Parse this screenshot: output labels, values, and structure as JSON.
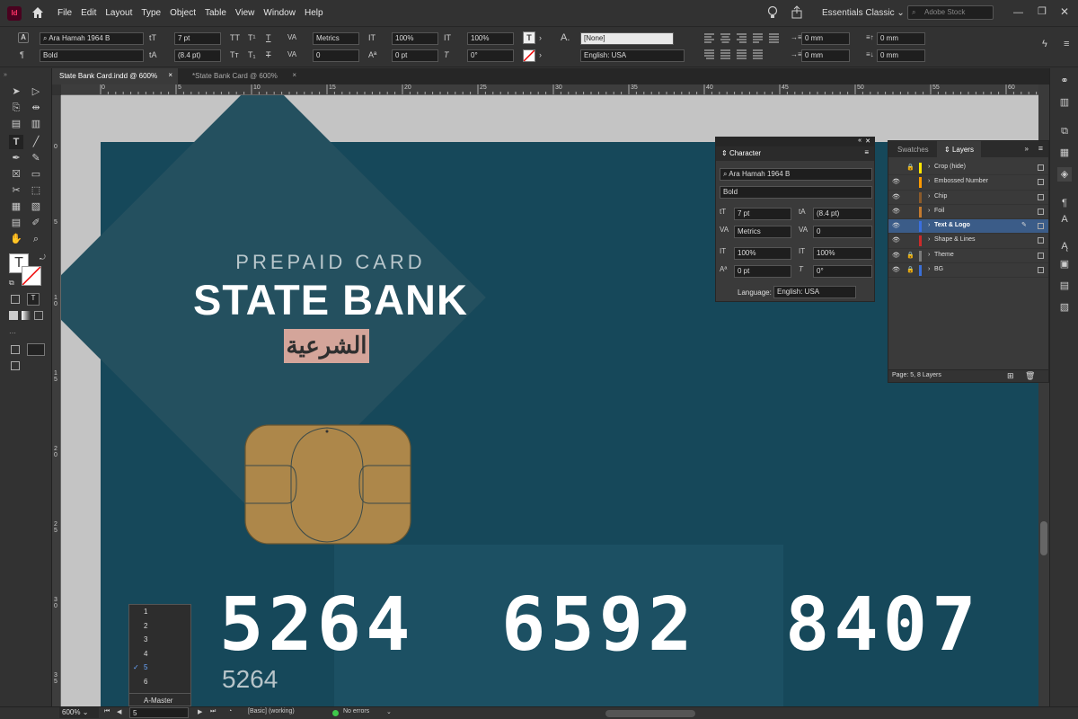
{
  "app": {
    "logo_text": "Id"
  },
  "menu": [
    "File",
    "Edit",
    "Layout",
    "Type",
    "Object",
    "Table",
    "View",
    "Window",
    "Help"
  ],
  "workspace": "Essentials Classic",
  "stock_placeholder": "Adobe Stock",
  "control": {
    "font": "Ara Hamah 1964 B",
    "style": "Bold",
    "size": "7 pt",
    "leading": "(8.4 pt)",
    "kerning": "Metrics",
    "tracking": "0",
    "vscale": "100%",
    "hscale": "100%",
    "baseline": "0 pt",
    "skew": "0°",
    "charstyle": "[None]",
    "language": "English: USA",
    "indent1": "0 mm",
    "indent2": "0 mm",
    "indent3": "0 mm",
    "indent4": "0 mm"
  },
  "tabs": [
    "State Bank Card.indd @ 600%",
    "*State Bank Card @ 600%"
  ],
  "ruler_h": [
    "0",
    "5",
    "10",
    "15",
    "20",
    "25",
    "30",
    "35",
    "40",
    "45",
    "50",
    "55",
    "60"
  ],
  "ruler_v": [
    "0",
    "5",
    "1\n0",
    "1\n5",
    "2\n0",
    "2\n5",
    "3\n0",
    "3\n5"
  ],
  "card": {
    "subtitle": "PREPAID CARD",
    "title": "STATE BANK",
    "arabic": "الشرعية",
    "num1": "5264",
    "num2": "6592",
    "num3": "8407",
    "num_small": "5264",
    "bg_color": "#16485a"
  },
  "character_panel": {
    "title": "Character",
    "font": "Ara Hamah 1964 B",
    "style": "Bold",
    "size": "7 pt",
    "leading": "(8.4 pt)",
    "kerning": "Metrics",
    "tracking": "0",
    "vscale": "100%",
    "hscale": "100%",
    "baseline": "0 pt",
    "skew": "0°",
    "language_label": "Language:",
    "language": "English: USA"
  },
  "layers_panel": {
    "tab_swatches": "Swatches",
    "tab_layers": "Layers",
    "layers": [
      {
        "name": "Crop (hide)",
        "color": "#ffe600",
        "eye": false,
        "lock": true
      },
      {
        "name": "Embossed Number",
        "color": "#ff9a00",
        "eye": true,
        "lock": false
      },
      {
        "name": "Chip",
        "color": "#8a5a2a",
        "eye": true,
        "lock": false
      },
      {
        "name": "Foil",
        "color": "#c47a2e",
        "eye": true,
        "lock": false
      },
      {
        "name": "Text & Logo",
        "color": "#3a6fe0",
        "eye": true,
        "lock": false,
        "selected": true
      },
      {
        "name": "Shape & Lines",
        "color": "#cc2a2a",
        "eye": true,
        "lock": false
      },
      {
        "name": "Theme",
        "color": "#7a7a7a",
        "eye": true,
        "lock": true
      },
      {
        "name": "BG",
        "color": "#3a6fd8",
        "eye": true,
        "lock": true
      }
    ],
    "footer": "Page: 5, 8 Layers"
  },
  "page_menu": [
    "1",
    "2",
    "3",
    "4",
    "5",
    "6",
    "A-Master"
  ],
  "page_menu_selected": "5",
  "status": {
    "zoom": "600%",
    "page": "5",
    "style": "[Basic] (working)",
    "errors": "No errors"
  }
}
